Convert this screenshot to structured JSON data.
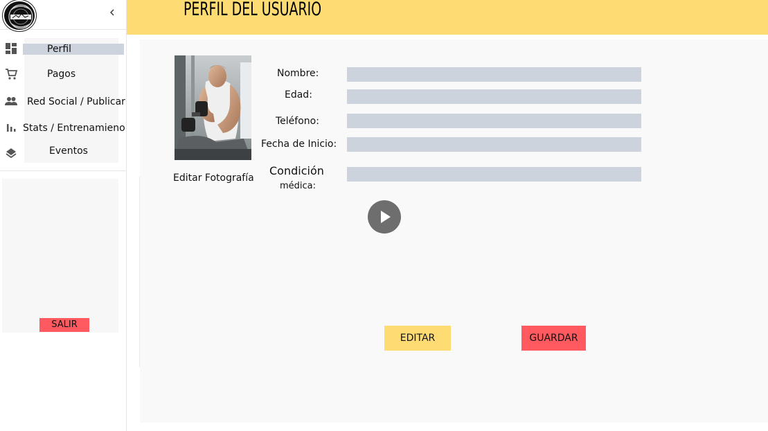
{
  "app": {
    "title": "PERFIL DEL USUARIO"
  },
  "sidebar": {
    "collapse_icon": "chevron-left-icon",
    "items": [
      {
        "label": "Perfil",
        "icon": "dashboard-icon",
        "active": true
      },
      {
        "label": "Pagos",
        "icon": "cart-icon",
        "active": false
      },
      {
        "label": "Red Social / Publicar",
        "icon": "people-icon",
        "active": false
      },
      {
        "label": "Stats / Entrenamieno",
        "icon": "bar-chart-icon",
        "active": false
      },
      {
        "label": "Eventos",
        "icon": "layers-icon",
        "active": false
      }
    ],
    "logout_label": "SALIR"
  },
  "profile": {
    "edit_photo_label": "Editar Fotografía",
    "fields": [
      {
        "label": "Nombre:",
        "value": ""
      },
      {
        "label": "Edad:",
        "value": ""
      },
      {
        "label": "Teléfono:",
        "value": ""
      },
      {
        "label": "Fecha de Inicio:",
        "value": ""
      },
      {
        "label_line1": "Condición",
        "label_line2": "médica:",
        "value": ""
      }
    ],
    "play_icon": "play-icon"
  },
  "actions": {
    "edit_label": "EDITAR",
    "save_label": "GUARDAR"
  },
  "colors": {
    "header": "#ffdc73",
    "accent_red": "#ff5a5f",
    "input_bg": "#ccd3dc",
    "active_item": "#cdd3dc"
  }
}
